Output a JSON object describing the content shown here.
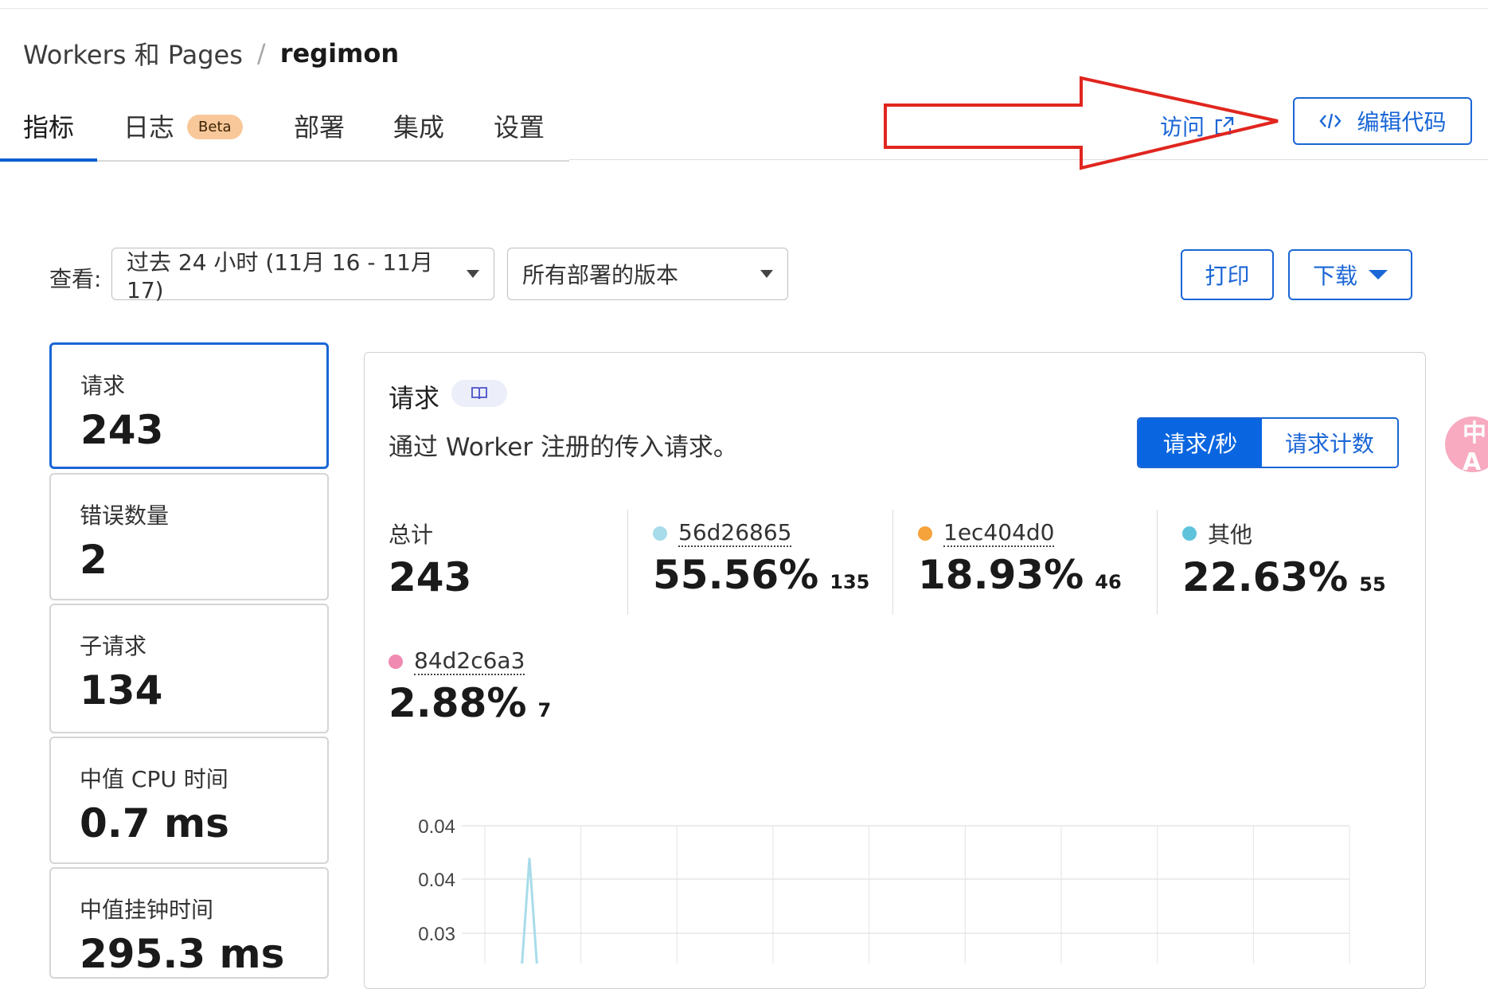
{
  "breadcrumb": {
    "parent": "Workers 和 Pages",
    "separator": "/",
    "current": "regimon"
  },
  "tabs": [
    {
      "label": "指标",
      "active": true
    },
    {
      "label": "日志",
      "badge": "Beta"
    },
    {
      "label": "部署"
    },
    {
      "label": "集成"
    },
    {
      "label": "设置"
    }
  ],
  "header_actions": {
    "visit_label": "访问",
    "edit_code_label": "编辑代码"
  },
  "filters": {
    "view_label": "查看:",
    "time_range": "过去 24 小时 (11月 16 - 11月 17)",
    "version": "所有部署的版本",
    "print_label": "打印",
    "download_label": "下载"
  },
  "metrics": [
    {
      "label": "请求",
      "value": "243",
      "active": true
    },
    {
      "label": "错误数量",
      "value": "2"
    },
    {
      "label": "子请求",
      "value": "134"
    },
    {
      "label": "中值 CPU 时间",
      "value": "0.7 ms"
    },
    {
      "label": "中值挂钟时间",
      "value": "295.3 ms"
    }
  ],
  "panel": {
    "title": "请求",
    "description": "通过 Worker 注册的传入请求。",
    "toggle": {
      "rate_label": "请求/秒",
      "count_label": "请求计数",
      "selected": "rate"
    },
    "stats": [
      {
        "label": "总计",
        "value": "243"
      },
      {
        "label": "56d26865",
        "value": "55.56%",
        "count": "135",
        "color": "#a8dcea"
      },
      {
        "label": "1ec404d0",
        "value": "18.93%",
        "count": "46",
        "color": "#f5a33a"
      },
      {
        "label": "其他",
        "value": "22.63%",
        "count": "55",
        "color": "#5fc3db"
      },
      {
        "label": "84d2c6a3",
        "value": "2.88%",
        "count": "7",
        "color": "#f08ab0"
      }
    ]
  },
  "chart_data": {
    "type": "line",
    "ytick_labels": [
      "0.04",
      "0.04",
      "0.03"
    ],
    "series": [
      {
        "color": "#a8dcea",
        "values": [
          0.0,
          0.037,
          0.0
        ]
      }
    ]
  },
  "annotation": {
    "type": "red-arrow",
    "color": "#e0261f"
  },
  "side_widget": {
    "text": "中A"
  }
}
